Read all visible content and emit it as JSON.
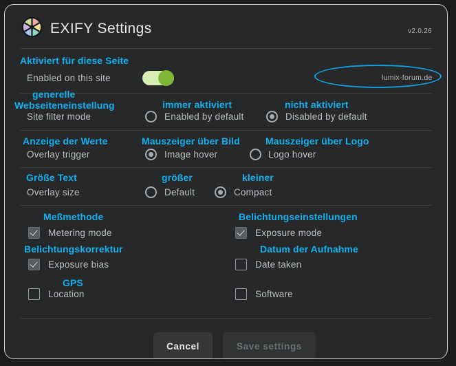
{
  "header": {
    "logo_icon": "aperture-icon",
    "title": "EXIFY Settings",
    "version": "v2.0.26"
  },
  "site_section": {
    "de_label": "Aktiviert für diese Seite",
    "en_label": "Enabled on this site",
    "toggle_state": "on",
    "domain_annotation": "lumix-forum.de",
    "annotation_shape": "ellipse-circle"
  },
  "filter_section": {
    "de_label_line1": "generelle",
    "de_label_line2": "Webseiteneinstellung",
    "en_label": "Site filter mode",
    "options": [
      {
        "de": "immer aktiviert",
        "en": "Enabled by default",
        "selected": false
      },
      {
        "de": "nicht aktiviert",
        "en": "Disabled by default",
        "selected": true
      }
    ]
  },
  "overlay_trigger_section": {
    "de_label": "Anzeige der Werte",
    "en_label": "Overlay trigger",
    "options": [
      {
        "de": "Mauszeiger über Bild",
        "en": "Image hover",
        "selected": true
      },
      {
        "de": "Mauszeiger über Logo",
        "en": "Logo hover",
        "selected": false
      }
    ]
  },
  "overlay_size_section": {
    "de_label": "Größe Text",
    "en_label": "Overlay size",
    "options": [
      {
        "de": "größer",
        "en": "Default",
        "selected": false
      },
      {
        "de": "kleiner",
        "en": "Compact",
        "selected": true
      }
    ]
  },
  "fields_section": {
    "left_column": [
      {
        "de": "Meßmethode",
        "en": "Metering mode",
        "checked": true
      },
      {
        "de": "Belichtungskorrektur",
        "en": "Exposure bias",
        "checked": true
      },
      {
        "de": "GPS",
        "en": "Location",
        "checked": false
      }
    ],
    "right_column": [
      {
        "de": "Belichtungseinstellungen",
        "en": "Exposure mode",
        "checked": true
      },
      {
        "de": "Datum der Aufnahme",
        "en": "Date taken",
        "checked": false
      },
      {
        "de": "",
        "en": "Software",
        "checked": false
      }
    ]
  },
  "footer": {
    "cancel_label": "Cancel",
    "save_label": "Save settings",
    "save_disabled": true
  },
  "colors": {
    "accent_annotation": "#12b0ef",
    "toggle_on_knob": "#7fb636",
    "toggle_on_track": "#d8edb4",
    "dialog_bg": "#272829",
    "text_primary": "#e7e9ea",
    "text_secondary": "#bcbfc1"
  }
}
